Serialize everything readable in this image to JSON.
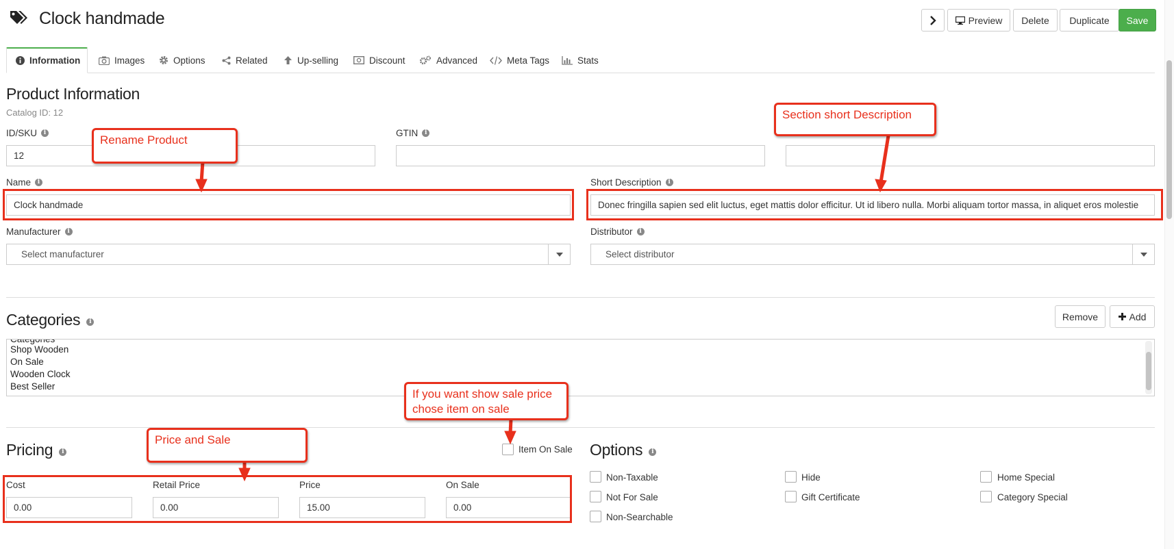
{
  "header": {
    "title": "Clock handmade",
    "buttons": {
      "next": "",
      "preview": "Preview",
      "delete": "Delete",
      "duplicate": "Duplicate",
      "save": "Save"
    }
  },
  "tabs": [
    {
      "label": "Information",
      "icon": "info-circle-icon",
      "active": true
    },
    {
      "label": "Images",
      "icon": "camera-icon"
    },
    {
      "label": "Options",
      "icon": "gear-icon"
    },
    {
      "label": "Related",
      "icon": "share-icon"
    },
    {
      "label": "Up-selling",
      "icon": "arrow-up-icon"
    },
    {
      "label": "Discount",
      "icon": "money-icon"
    },
    {
      "label": "Advanced",
      "icon": "gears-icon"
    },
    {
      "label": "Meta Tags",
      "icon": "code-icon"
    },
    {
      "label": "Stats",
      "icon": "bar-chart-icon"
    }
  ],
  "product_info": {
    "title": "Product Information",
    "catalog_id": "Catalog ID: 12",
    "sku_label": "ID/SKU",
    "sku_value": "12",
    "gtin_label": "GTIN",
    "gtin_value": "",
    "third_value": "",
    "name_label": "Name",
    "name_value": "Clock handmade",
    "short_desc_label": "Short Description",
    "short_desc_value": "Donec fringilla sapien sed elit luctus, eget mattis dolor efficitur. Ut id libero nulla. Morbi aliquam tortor massa, in aliquet eros molestie",
    "manufacturer_label": "Manufacturer",
    "manufacturer_value": "Select manufacturer",
    "distributor_label": "Distributor",
    "distributor_value": "Select distributor"
  },
  "categories": {
    "title": "Categories",
    "remove_label": "Remove",
    "add_label": "Add",
    "items": [
      "Categories",
      "Shop Wooden",
      "On Sale",
      "Wooden Clock",
      "Best Seller"
    ]
  },
  "pricing": {
    "title": "Pricing",
    "item_on_sale_label": "Item On Sale",
    "item_on_sale_checked": false,
    "cost_label": "Cost",
    "cost_value": "0.00",
    "retail_label": "Retail Price",
    "retail_value": "0.00",
    "price_label": "Price",
    "price_value": "15.00",
    "on_sale_label": "On Sale",
    "on_sale_value": "0.00"
  },
  "options": {
    "title": "Options",
    "checkboxes": [
      {
        "label": "Non-Taxable",
        "checked": false
      },
      {
        "label": "Hide",
        "checked": false
      },
      {
        "label": "Home Special",
        "checked": false
      },
      {
        "label": "Not For Sale",
        "checked": false
      },
      {
        "label": "Gift Certificate",
        "checked": false
      },
      {
        "label": "Category Special",
        "checked": false
      },
      {
        "label": "Non-Searchable",
        "checked": false
      }
    ]
  },
  "annotations": {
    "rename": "Rename Product",
    "short_desc": "Section short Description",
    "price_sale": "Price and Sale",
    "on_sale_line1": "If you want show sale price",
    "on_sale_line2": "chose item on sale"
  },
  "colors": {
    "accent": "#4cae4c",
    "annotation": "#e8301c"
  }
}
